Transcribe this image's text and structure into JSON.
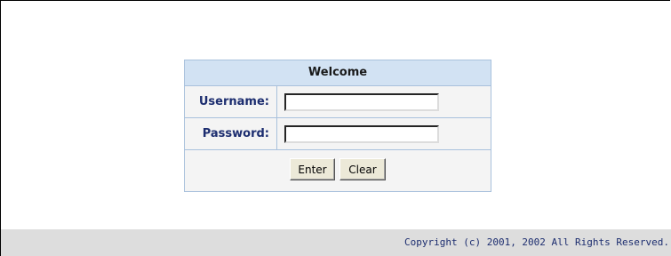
{
  "login": {
    "title": "Welcome",
    "username_label": "Username:",
    "username_value": "",
    "password_label": "Password:",
    "password_value": "",
    "enter_label": "Enter",
    "clear_label": "Clear"
  },
  "footer": {
    "copyright": "Copyright (c) 2001, 2002 All Rights Reserved."
  },
  "colors": {
    "header_bg": "#d2e2f3",
    "border": "#a9c1dc",
    "label_text": "#1c2d6f",
    "footer_bg": "#dddddd"
  }
}
